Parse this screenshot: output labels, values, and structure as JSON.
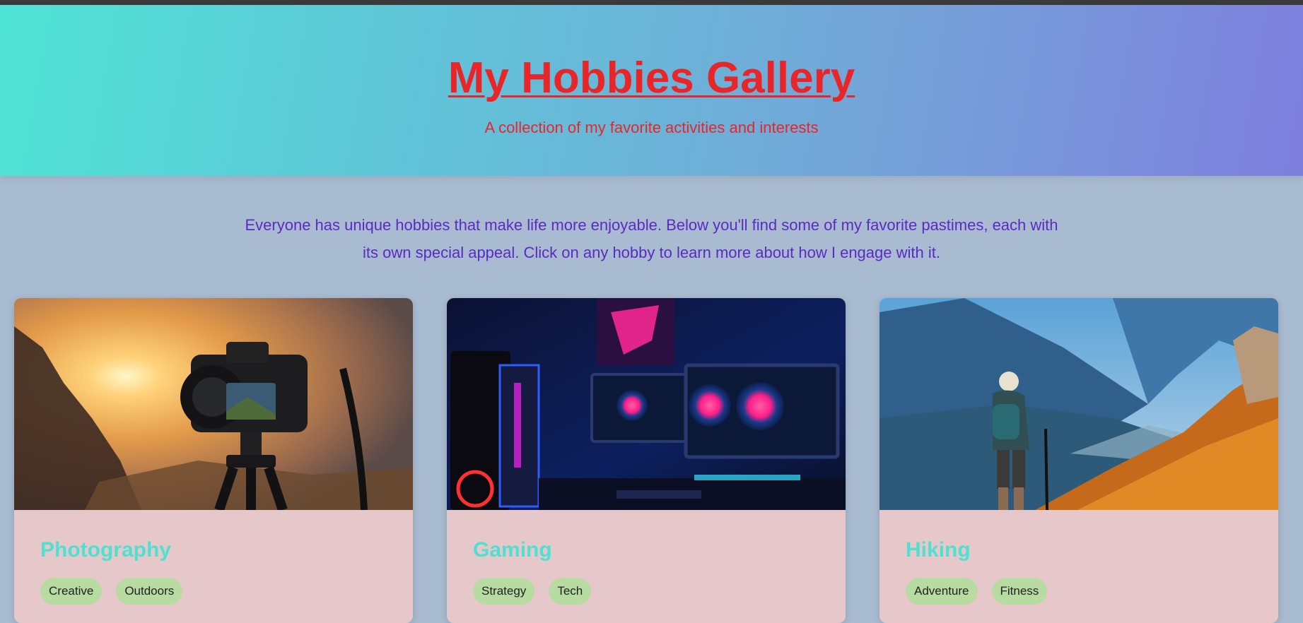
{
  "header": {
    "title": "My Hobbies Gallery",
    "subtitle": "A collection of my favorite activities and interests"
  },
  "intro": {
    "text": "Everyone has unique hobbies that make life more enjoyable. Below you'll find some of my favorite pastimes, each with its own special appeal. Click on any hobby to learn more about how I engage with it."
  },
  "cards": [
    {
      "title": "Photography",
      "image_description": "camera-on-tripod-sunset",
      "tags": [
        "Creative",
        "Outdoors"
      ]
    },
    {
      "title": "Gaming",
      "image_description": "neon-gaming-setup",
      "tags": [
        "Strategy",
        "Tech"
      ]
    },
    {
      "title": "Hiking",
      "image_description": "hiker-mountain-valley",
      "tags": [
        "Adventure",
        "Fitness"
      ]
    }
  ],
  "colors": {
    "title": "#e8262a",
    "intro_text": "#5a2bc4",
    "card_title": "#4fe0d0",
    "tag_bg": "#b7dba1",
    "card_bg": "#e6c8cb",
    "page_bg": "#a9bbd0"
  }
}
